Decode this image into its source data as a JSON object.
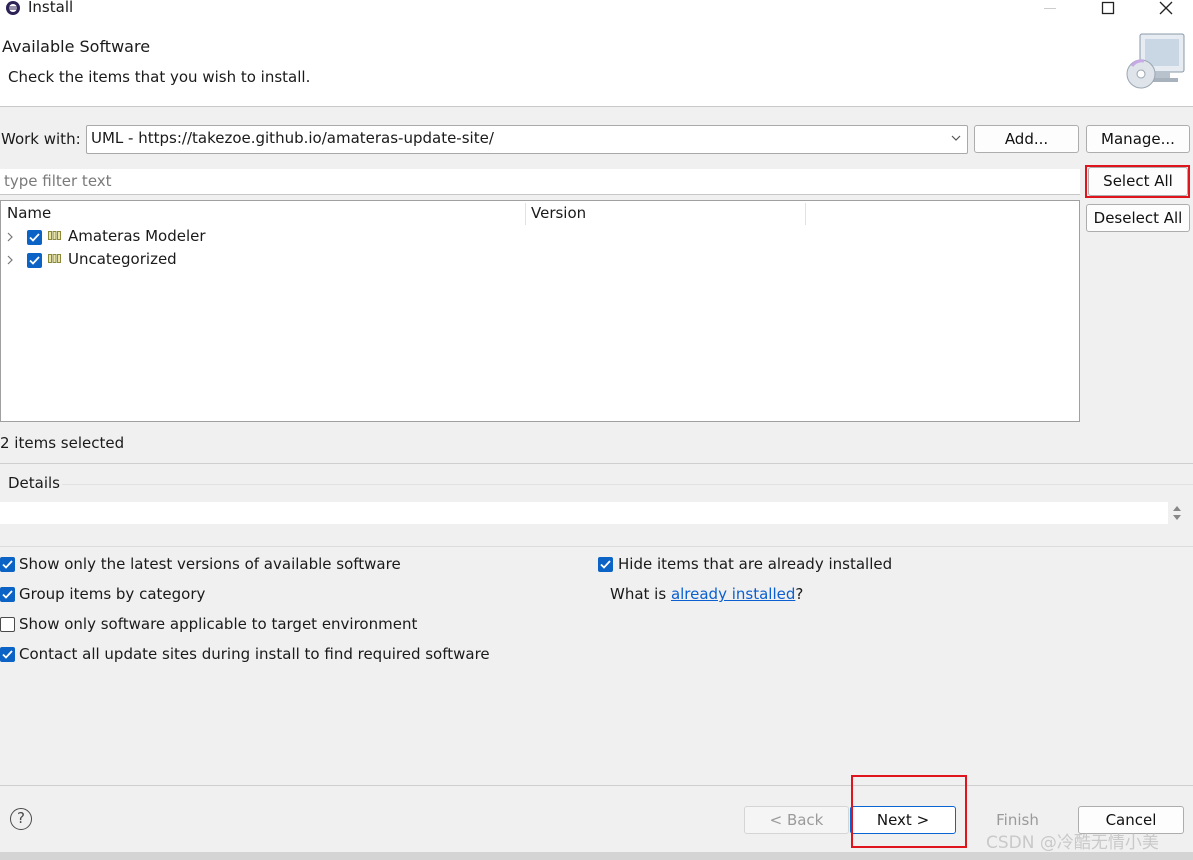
{
  "window": {
    "title": "Install",
    "minimize_label": "—",
    "maximize_label": "□",
    "close_label": "✕"
  },
  "header": {
    "title": "Available Software",
    "description": "Check the items that you wish to install."
  },
  "work_with": {
    "label": "Work with:",
    "value": "UML - https://takezoe.github.io/amateras-update-site/",
    "add_button": "Add...",
    "manage_button": "Manage..."
  },
  "filter": {
    "placeholder": "type filter text"
  },
  "side_buttons": {
    "select_all": "Select All",
    "deselect_all": "Deselect All"
  },
  "table": {
    "columns": [
      "Name",
      "Version"
    ],
    "rows": [
      {
        "name": "Amateras Modeler",
        "version": "",
        "checked": true
      },
      {
        "name": "Uncategorized",
        "version": "",
        "checked": true
      }
    ]
  },
  "status": {
    "selected_count": "2 items selected"
  },
  "details": {
    "label": "Details"
  },
  "options": {
    "latest_versions": {
      "label": "Show only the latest versions of available software",
      "checked": true
    },
    "group_by_category": {
      "label": "Group items by category",
      "checked": true
    },
    "target_environment": {
      "label": "Show only software applicable to target environment",
      "checked": false
    },
    "contact_all_sites": {
      "label": "Contact all update sites during install to find required software",
      "checked": true
    },
    "hide_installed": {
      "label": "Hide items that are already installed",
      "checked": true
    },
    "what_is_prefix": "What is ",
    "already_installed_link": "already installed",
    "what_is_suffix": "?"
  },
  "footer": {
    "help_label": "?",
    "back_button": "< Back",
    "next_button": "Next >",
    "finish_button": "Finish",
    "cancel_button": "Cancel"
  },
  "watermark": "CSDN @冷酷无情小美",
  "colors": {
    "accent": "#0b63c5",
    "highlight_box": "#e0141c",
    "link": "#0b5fd1"
  }
}
